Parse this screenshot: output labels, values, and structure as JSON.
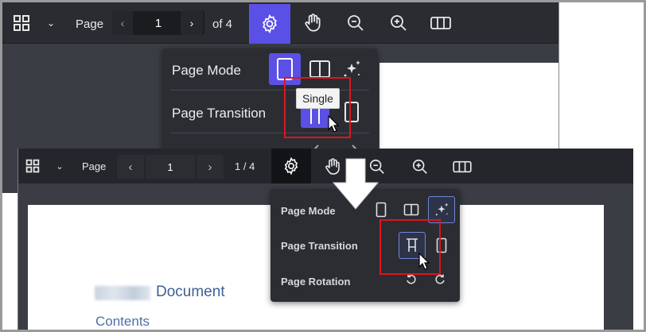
{
  "top_view": {
    "toolbar": {
      "page_label": "Page",
      "page_number": "1",
      "page_of": "of 4",
      "prev_glyph": "‹",
      "next_glyph": "›",
      "chevron_glyph": "⌄",
      "icons": [
        "grid-icon",
        "chevron-down-icon",
        "gear-icon",
        "hand-icon",
        "zoom-out-icon",
        "zoom-in-icon",
        "columns-icon"
      ]
    },
    "settings_popup": {
      "page_mode_label": "Page Mode",
      "page_transition_label": "Page Transition",
      "tooltip": "Single"
    }
  },
  "bottom_view": {
    "toolbar": {
      "page_label": "Page",
      "page_number": "1",
      "page_count": "1 / 4",
      "prev_glyph": "‹",
      "next_glyph": "›",
      "chevron_glyph": "⌄"
    },
    "settings_popup": {
      "page_mode_label": "Page Mode",
      "page_transition_label": "Page Transition",
      "page_rotation_label": "Page Rotation"
    },
    "document": {
      "title": "Document",
      "subtitle": "Contents"
    }
  },
  "colors": {
    "accent": "#5b50e6",
    "highlight_border": "#e0141c",
    "toolbar_bg": "#2a2c31",
    "popup_bg": "#2b2d33",
    "doc_link": "#3f5f95"
  }
}
